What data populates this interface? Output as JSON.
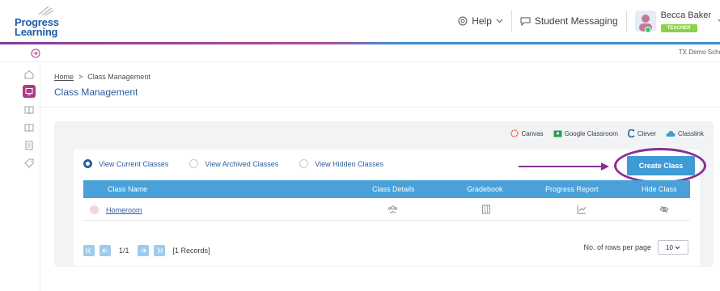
{
  "brand": {
    "logo_line1": "Progress",
    "logo_line2": "Learning"
  },
  "header": {
    "help_label": "Help",
    "messaging_label": "Student Messaging",
    "user_name": "Becca Baker",
    "user_role": "TEACHER"
  },
  "school": {
    "name": "TX Demo Scho"
  },
  "breadcrumb": {
    "home": "Home",
    "separator": ">",
    "current": "Class Management"
  },
  "page": {
    "title": "Class Management"
  },
  "integrations": [
    "Canvas",
    "Google Classroom",
    "Clever",
    "Classlink"
  ],
  "filters": {
    "current": "View Current Classes",
    "archived": "View Archived Classes",
    "hidden": "View Hidden Classes"
  },
  "create_button": "Create Class",
  "table": {
    "columns": [
      "Class Name",
      "Class Details",
      "Gradebook",
      "Progress Report",
      "Hide Class"
    ],
    "rows": [
      {
        "class_name": "Homeroom"
      }
    ]
  },
  "pagination": {
    "page": "1/1",
    "records": "[1 Records]",
    "rows_label": "No. of rows per page",
    "rows_value": "10"
  },
  "colors": {
    "accent": "#3e9bd6",
    "brand_purple": "#8a2f8f",
    "table_header": "#4aa0d8",
    "link": "#2a5d9a"
  },
  "icons": [
    "help-icon",
    "chevron-down-icon",
    "chat-icon",
    "expand-icon",
    "home-icon",
    "classroom-icon",
    "book-icon",
    "library-icon",
    "report-icon",
    "tag-icon",
    "group-icon",
    "gradebook-icon",
    "chart-icon",
    "eye-off-icon"
  ]
}
